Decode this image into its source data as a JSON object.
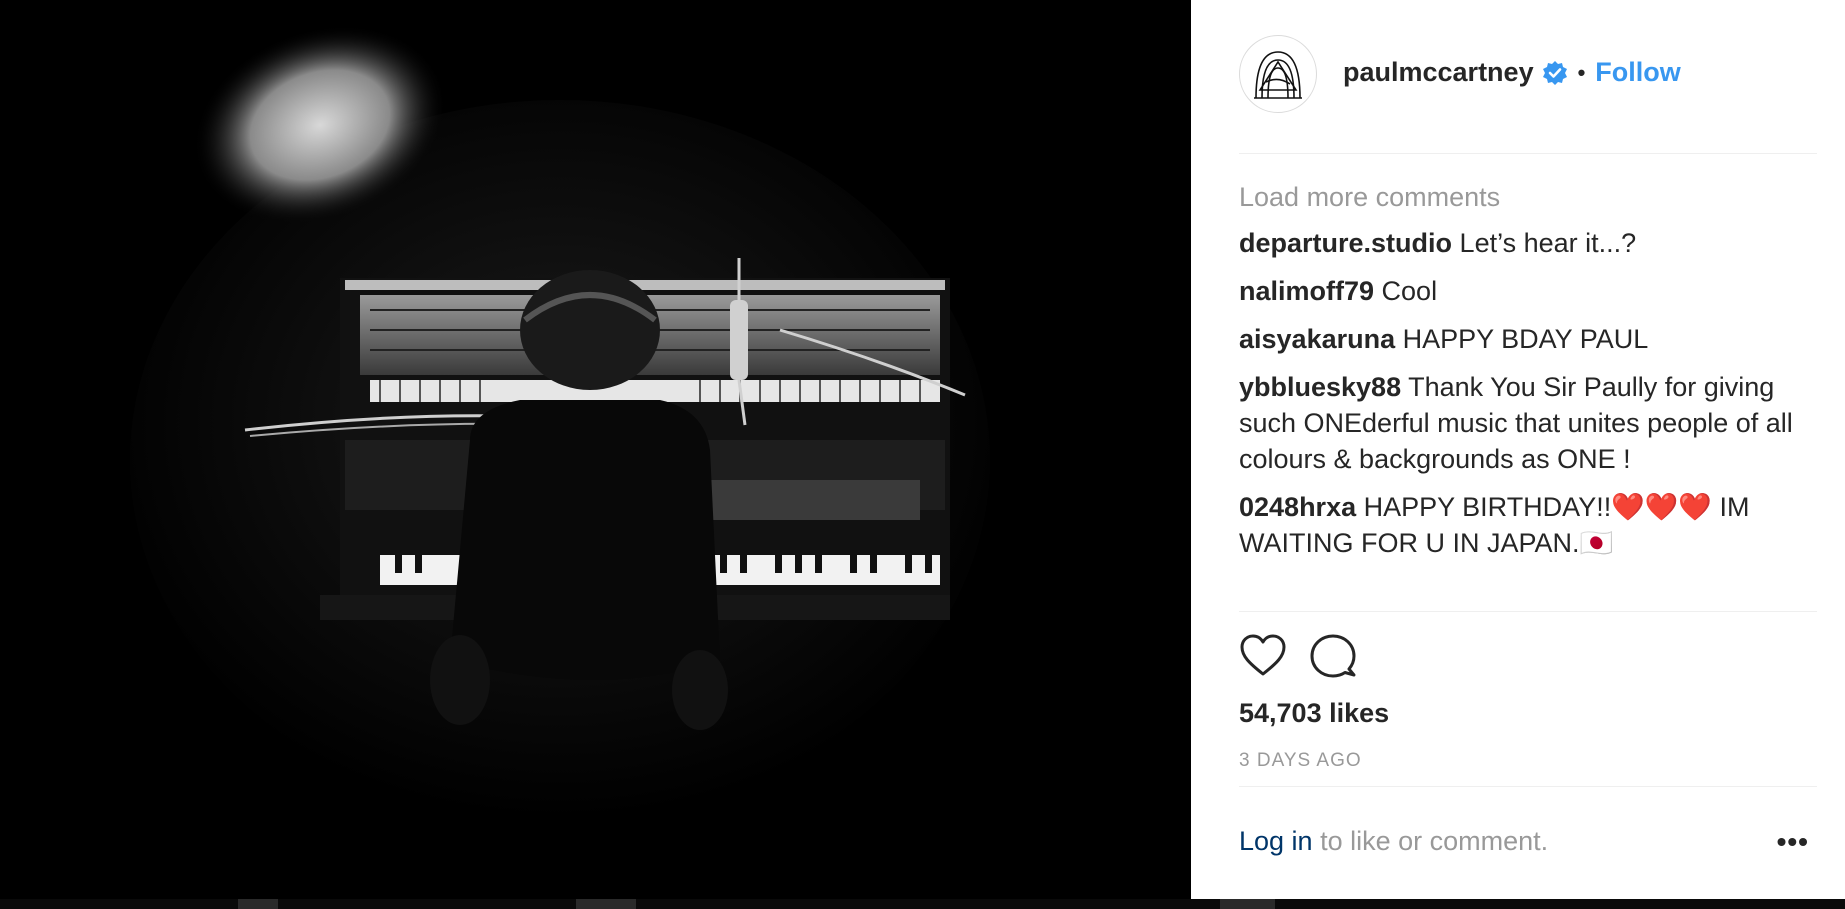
{
  "post": {
    "username": "paulmccartney",
    "verified_icon": "verified-badge-icon",
    "separator": "•",
    "follow_label": "Follow",
    "load_more_label": "Load more comments",
    "comments": [
      {
        "author": "departure.studio",
        "text": "Let’s hear it...?"
      },
      {
        "author": "nalimoff79",
        "text": "Cool"
      },
      {
        "author": "aisyakaruna",
        "text": "HAPPY BDAY PAUL"
      },
      {
        "author": "ybbluesky88",
        "text": "Thank You Sir Paully for giving such ONEderful music that unites people of all colours & backgrounds as ONE !"
      },
      {
        "author": "0248hrxa",
        "text": "HAPPY BIRTHDAY!!❤️❤️❤️ IM WAITING FOR U IN JAPAN.🇯🇵"
      }
    ],
    "likes_label": "54,703 likes",
    "timestamp": "3 DAYS AGO",
    "login_link": "Log in",
    "login_rest": " to like or comment.",
    "more_label": "•••"
  },
  "icons": {
    "like": "heart-outline-icon",
    "comment": "comment-bubble-icon",
    "avatar": "profile-logo-icon"
  },
  "colors": {
    "follow": "#3897f0",
    "verified": "#3897f0",
    "muted_text": "#999999",
    "primary_text": "#262626",
    "login_link": "#003569"
  }
}
